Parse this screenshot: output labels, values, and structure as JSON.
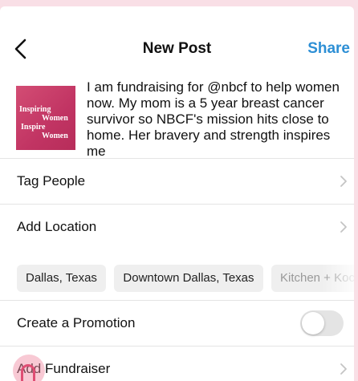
{
  "header": {
    "title": "New Post",
    "share_label": "Share",
    "back_icon": "chevron-left-icon"
  },
  "post": {
    "thumbnail_lines": [
      "Inspiring",
      "Women",
      "Inspire",
      "Women"
    ],
    "caption": "I am fundraising for @nbcf to help women now. My mom is a 5 year breast cancer survivor so NBCF's mission hits close to home. Her bravery and strength inspires me"
  },
  "rows": {
    "tag_people": "Tag People",
    "add_location": "Add Location",
    "create_promotion": "Create a Promotion",
    "add_fundraiser": "Add Fundraiser"
  },
  "location_chips": [
    "Dallas, Texas",
    "Downtown Dallas, Texas",
    "Kitchen + Kocktails"
  ],
  "promotion_toggle": {
    "on": false
  },
  "colors": {
    "accent": "#2d8fd5",
    "thumbnail": "#c13463",
    "background": "#f9dfe6"
  }
}
